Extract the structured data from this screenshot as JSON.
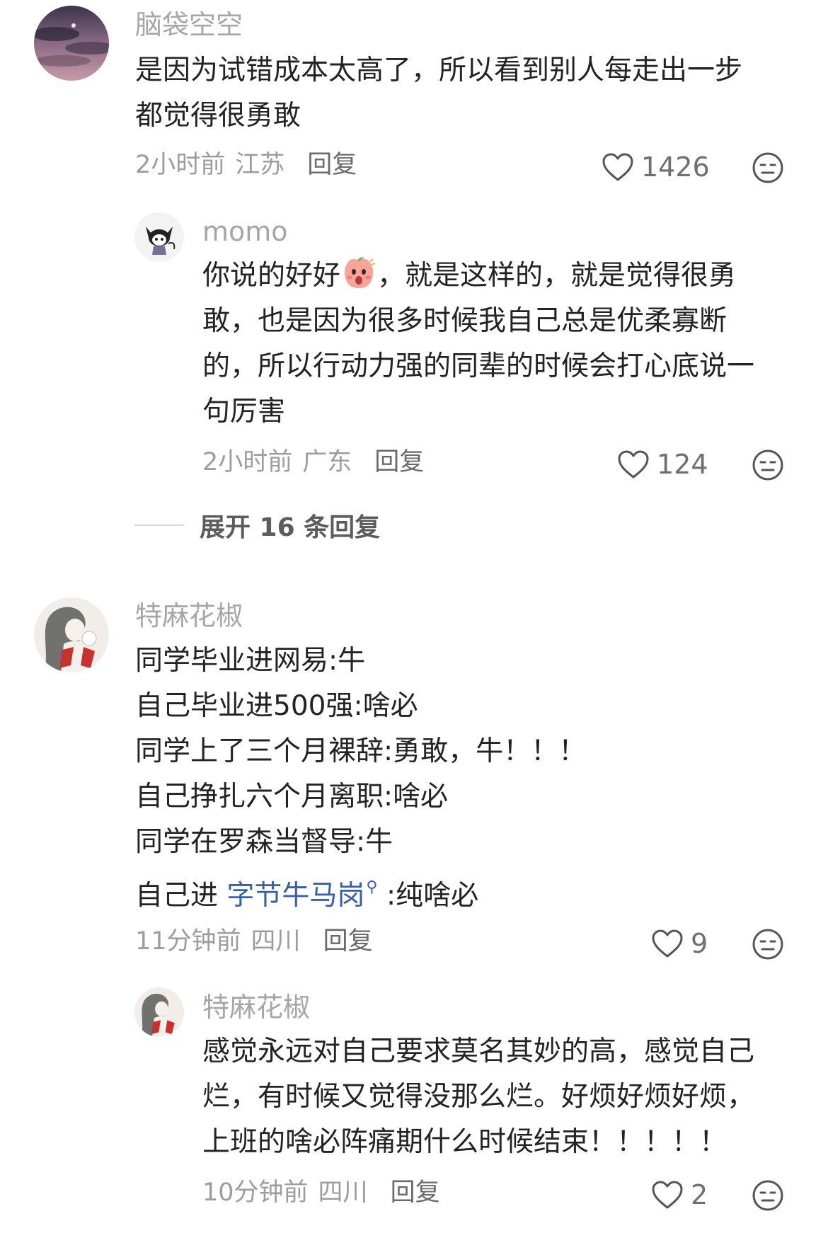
{
  "comments": [
    {
      "username": "脑袋空空",
      "lines": [
        "是因为试错成本太高了，所以看到别人每走出一步",
        "都觉得很勇敢"
      ],
      "time": "2小时前",
      "location": "江苏",
      "reply_label": "回复",
      "likes": "1426",
      "replies": [
        {
          "username": "momo",
          "line1_pre": "你说的好好",
          "line1_post": "，就是这样的，就是觉得很勇",
          "lines": [
            "敢，也是因为很多时候我自己总是优柔寡断",
            "的，所以行动力强的同辈的时候会打心底说一",
            "句厉害"
          ],
          "time": "2小时前",
          "location": "广东",
          "reply_label": "回复",
          "likes": "124"
        }
      ],
      "expand_label": "展开 16 条回复"
    },
    {
      "username": "特麻花椒",
      "lines": [
        "同学毕业进网易:牛",
        "自己毕业进500强:啥必",
        "同学上了三个月裸辞:勇敢，牛！！！",
        "自己挣扎六个月离职:啥必",
        "同学在罗森当督导:牛"
      ],
      "last_line_pre": "自己进 ",
      "last_line_link": "字节牛马岗",
      "last_line_post": " :纯啥必",
      "time": "11分钟前",
      "location": "四川",
      "reply_label": "回复",
      "likes": "9",
      "replies": [
        {
          "username": "特麻花椒",
          "lines": [
            "感觉永远对自己要求莫名其妙的高，感觉自己",
            "烂，有时候又觉得没那么烂。好烦好烦好烦，",
            "上班的啥必阵痛期什么时候结束！！！！！"
          ],
          "time": "10分钟前",
          "location": "四川",
          "reply_label": "回复",
          "likes": "2"
        }
      ]
    }
  ],
  "icons": {
    "like": "heart-outline-icon",
    "dislike": "neutral-face-icon",
    "link_search": "search-icon",
    "emoji": "shocked-peach-emoji"
  },
  "colors": {
    "username": "#a6a6a6",
    "text": "#232323",
    "meta": "#9d9d9d",
    "link": "#3a5fa8"
  }
}
